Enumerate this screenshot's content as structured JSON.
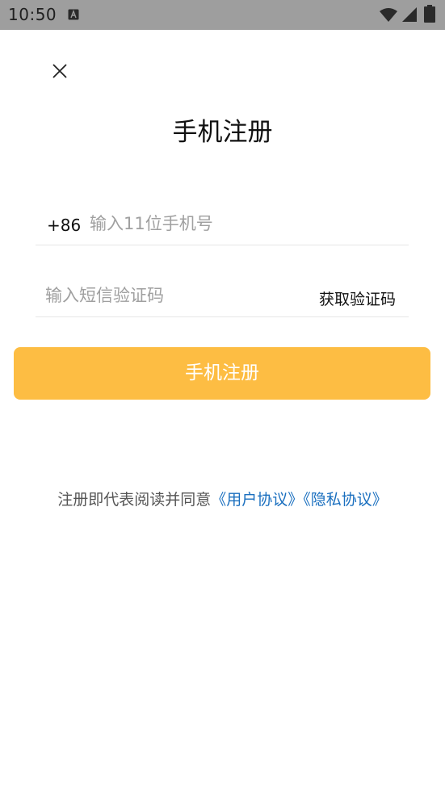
{
  "status_bar": {
    "time": "10:50",
    "icons": [
      "a-notification-icon",
      "wifi-icon",
      "signal-icon",
      "battery-icon"
    ]
  },
  "header": {
    "close_icon": "close-icon",
    "title": "手机注册"
  },
  "form": {
    "country_code": "+86",
    "phone_placeholder": "输入11位手机号",
    "code_placeholder": "输入短信验证码",
    "get_code_label": "获取验证码",
    "submit_label": "手机注册"
  },
  "agreement": {
    "prefix": "注册即代表阅读并同意",
    "user_agreement": "《用户协议》",
    "privacy_policy": "《隐私协议》"
  },
  "colors": {
    "accent": "#fdbd43",
    "link": "#1a6fbf",
    "status_bar": "#9e9e9e"
  }
}
